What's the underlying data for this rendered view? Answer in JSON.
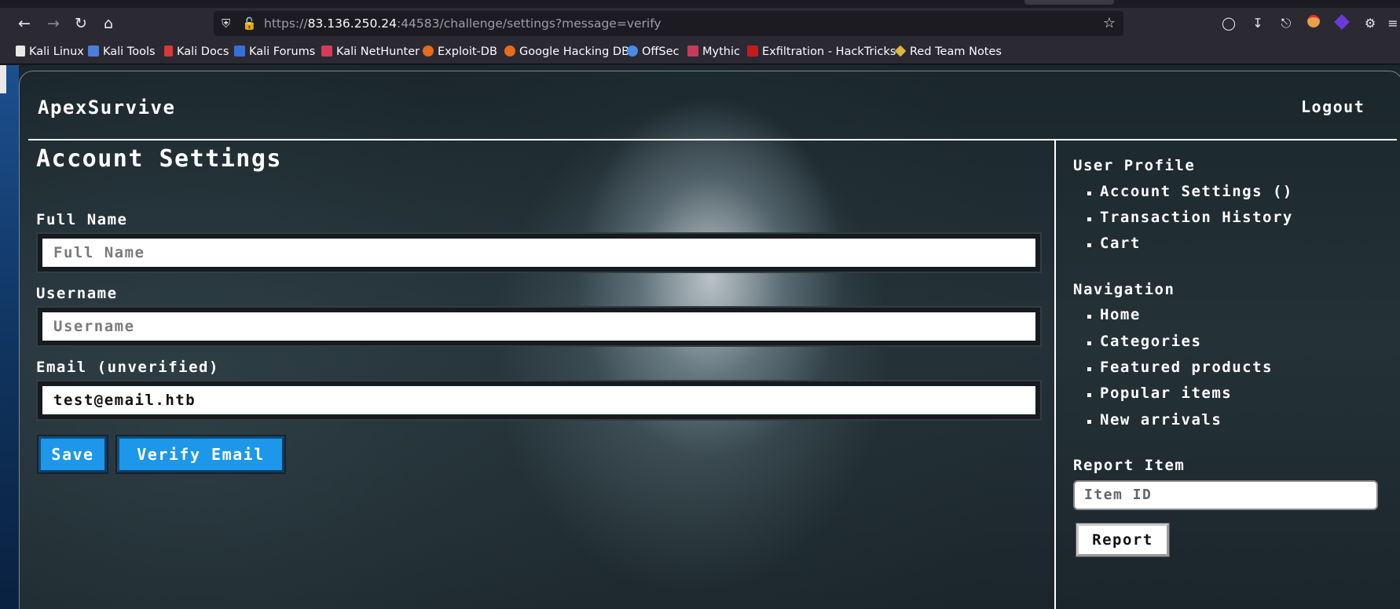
{
  "browser": {
    "url_prefix": "https://",
    "url_host": "83.136.250.24",
    "url_rest": ":44583/challenge/settings?message=verify",
    "bookmarks": [
      {
        "label": "Kali Linux",
        "color": "#e8e8e8"
      },
      {
        "label": "Kali Tools",
        "color": "#4a7fd8"
      },
      {
        "label": "Kali Docs",
        "color": "#d33a3a"
      },
      {
        "label": "Kali Forums",
        "color": "#3a6fd8"
      },
      {
        "label": "Kali NetHunter",
        "color": "#d83a5a"
      },
      {
        "label": "Exploit-DB",
        "color": "#e86a1a"
      },
      {
        "label": "Google Hacking DB",
        "color": "#e86a1a"
      },
      {
        "label": "OffSec",
        "color": "#4a8ae8"
      },
      {
        "label": "Mythic",
        "color": "#c83a5a"
      },
      {
        "label": "Exfiltration - HackTricks",
        "color": "#c81a1a"
      },
      {
        "label": "Red Team Notes",
        "color": "#d8b83a"
      }
    ]
  },
  "app": {
    "brand": "ApexSurvive",
    "logout": "Logout"
  },
  "main": {
    "title": "Account Settings",
    "fields": [
      {
        "label": "Full Name",
        "placeholder": "Full Name",
        "value": ""
      },
      {
        "label": "Username",
        "placeholder": "Username",
        "value": ""
      },
      {
        "label": "Email (unverified)",
        "placeholder": "",
        "value": "test@email.htb"
      }
    ],
    "save_label": "Save",
    "verify_label": "Verify Email"
  },
  "sidebar": {
    "profile_heading": "User Profile",
    "profile_items": [
      "Account Settings ()",
      "Transaction History",
      "Cart"
    ],
    "nav_heading": "Navigation",
    "nav_items": [
      "Home",
      "Categories",
      "Featured products",
      "Popular items",
      "New arrivals"
    ],
    "report_heading": "Report Item",
    "report_placeholder": "Item ID",
    "report_button": "Report"
  },
  "colors": {
    "accent_button": "#1d97ea"
  }
}
